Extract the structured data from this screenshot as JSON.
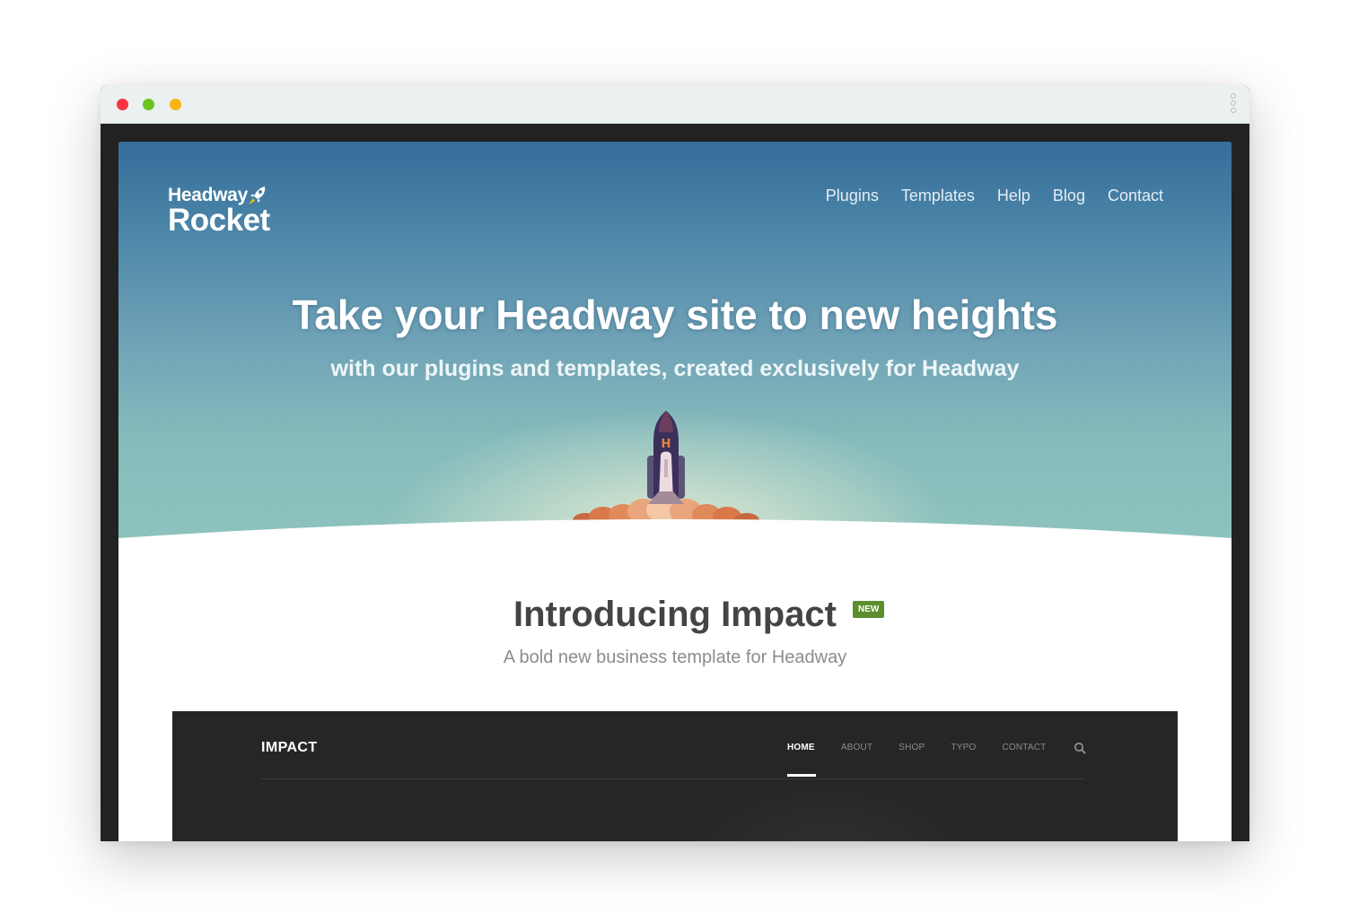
{
  "browser": {
    "controls": [
      "close-dot",
      "minimize-dot",
      "maximize-dot"
    ],
    "colors": {
      "close": "#fc3340",
      "minimize": "#6cc51d",
      "maximize": "#fbb315"
    }
  },
  "site": {
    "logo": {
      "line1": "Headway",
      "line2": "Rocket"
    },
    "nav": [
      "Plugins",
      "Templates",
      "Help",
      "Blog",
      "Contact"
    ],
    "hero": {
      "title": "Take your Headway site to new heights",
      "subtitle": "with our plugins and templates, created exclusively for Headway"
    },
    "intro": {
      "title": "Introducing Impact",
      "badge": "NEW",
      "subtitle": "A bold new business template for Headway"
    },
    "preview": {
      "logo": "IMPACT",
      "nav": [
        "HOME",
        "ABOUT",
        "SHOP",
        "TYPO",
        "CONTACT"
      ],
      "active_nav": "HOME"
    },
    "colors": {
      "badge": "#5b8e2d",
      "hero_top": "#366d9a",
      "hero_bottom": "#8ec3bd",
      "preview_bg": "#262626"
    }
  }
}
